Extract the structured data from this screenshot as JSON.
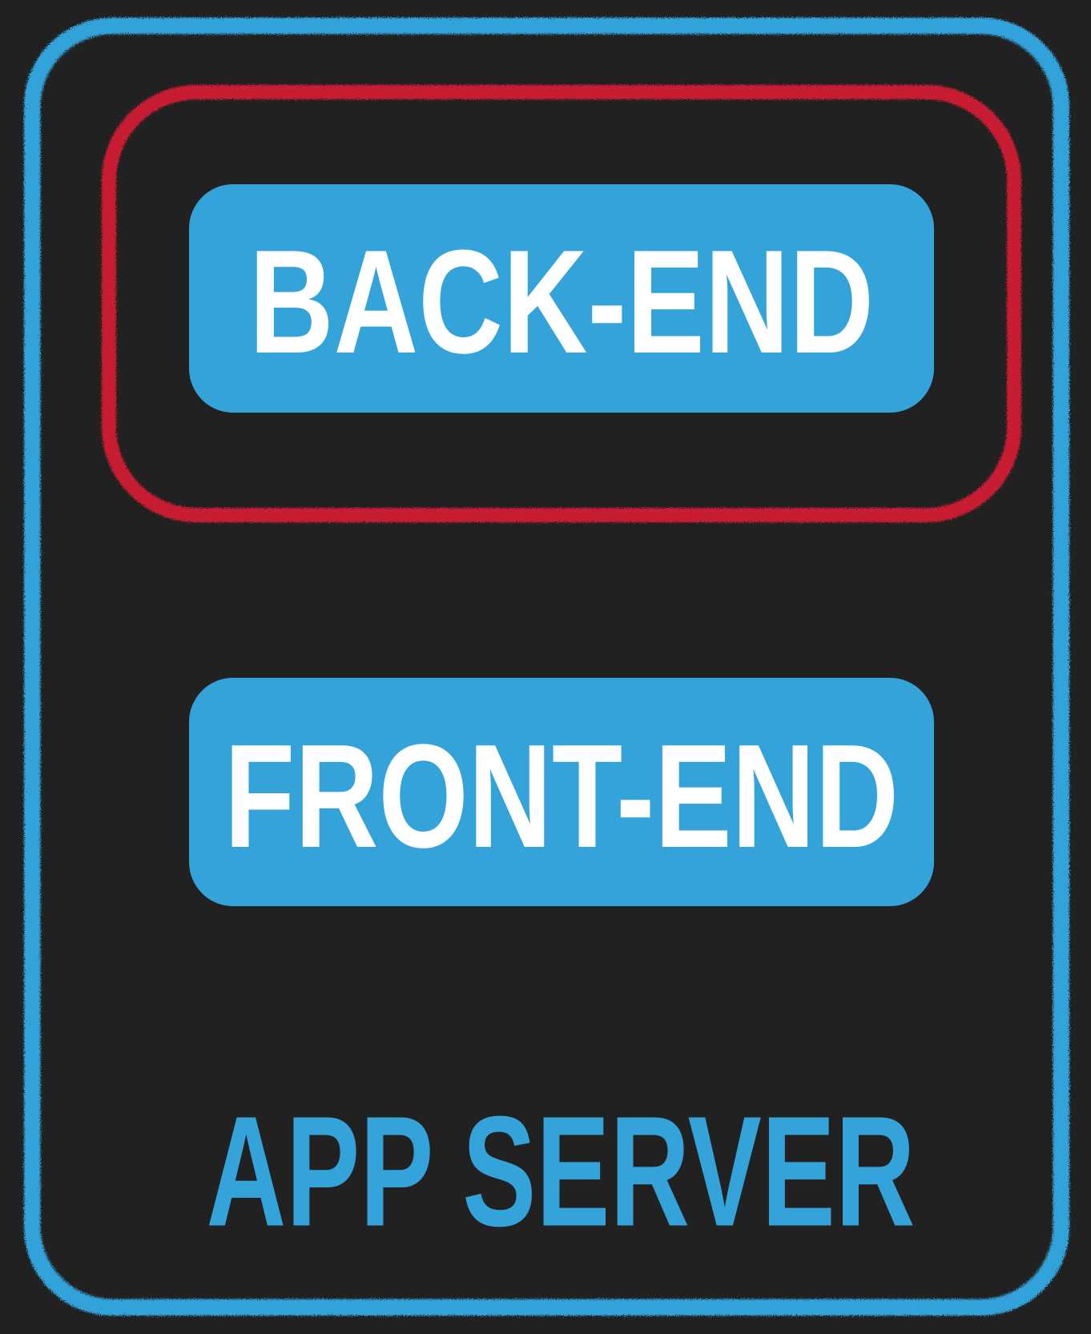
{
  "diagram": {
    "outer_box": {
      "label": "APP SERVER",
      "color": "#33a3da"
    },
    "highlight_box": {
      "color": "#c81e32"
    },
    "blocks": [
      {
        "label": "BACK-END",
        "fill": "#33a3da",
        "text_color": "#ffffff"
      },
      {
        "label": "FRONT-END",
        "fill": "#33a3da",
        "text_color": "#ffffff"
      }
    ],
    "background": "#212121"
  }
}
